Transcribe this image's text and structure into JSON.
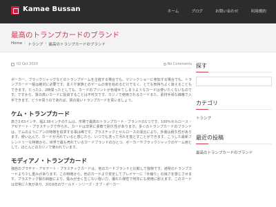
{
  "header": {
    "site_title": "Kamae Bussan",
    "nav": [
      "ホーム",
      "ブログ",
      "お問い合わせ",
      "利用規約"
    ]
  },
  "banner": {
    "title": "最高のトランプカードのブランド",
    "breadcrumb": [
      "Home",
      "トランプ",
      "最高のトランプカードのブランド"
    ]
  },
  "post": {
    "date": "02 Oct 2020",
    "comments": "No Comments",
    "intro": "ポーカー、ブラックジャックなどのトランプゲームを主催する場合でも、マジックショーに参加する場合でも、トランプカード一組は絶対に必要です。友人や家族とのゲームの夜を始めるだけでなく、とても気持ちよく扱えることもできます。たった1、2時間ったとしても、カードのプリントが色褪せてしまうようなカードは使いたくないものです。ですから、質の高いカードに投資することは不可欠です。カジノで使用されるカードまた、素材手頃な価格で入手できます。どうせ買うのであれば、質の高いトランプカードを買いましょう。",
    "section1_title": "ケム・トランプカード",
    "section1_body": "高さ3.63インチ、幅2.38インチのケムは、市場で最高のトランプカード・ブランドの1つです。100％セルロース・アセテート・プラスチックで作られ、カードは非常に柔軟で耐久性があります。多くのトランプカードのブランドは、ケムのようにアンの特徴を追求する事は稀です。プラスチックとセルロースの混合により、外装は耐久性があります。使い込んで、カードが汚れていると感じたら、いつでも洗って汚れを落とすことができます。こうした最新フレンドリーな特徴から、世界で最も売れているカードブランドのひとつ、ポーカーやブラックジャックのゲーム用として、ほとんどのカジノで使われています。",
    "section2_title": "モディアノ・トランプカード",
    "section2_body": "独自のプラチナ・アセテート・プラスチックカードは、他のカードブランドと比較して独特です。通常のトランプカードより少し重みがあります。この特徴から、他のカードより安定してプレイヤーに「手触り」の良さを感じさせます。プラスチック製の斜面により、傷みが全く生じない強い力、優れた弾性で何年にも使用に耐えます。このカードは非常に人気があり、2016年のワールド・シリーズ・オブ・ポーカー"
  },
  "sidebar": {
    "search_title": "探す",
    "categories_title": "カテゴリ",
    "categories": [
      "トランプ"
    ],
    "recent_title": "最近の投稿",
    "recent": [
      "最高のトランプカードのブランド"
    ]
  },
  "colors": {
    "header_bg": "#2a2c2e",
    "accent": "#d23b54",
    "banner_bg": "#f3f3f3"
  }
}
